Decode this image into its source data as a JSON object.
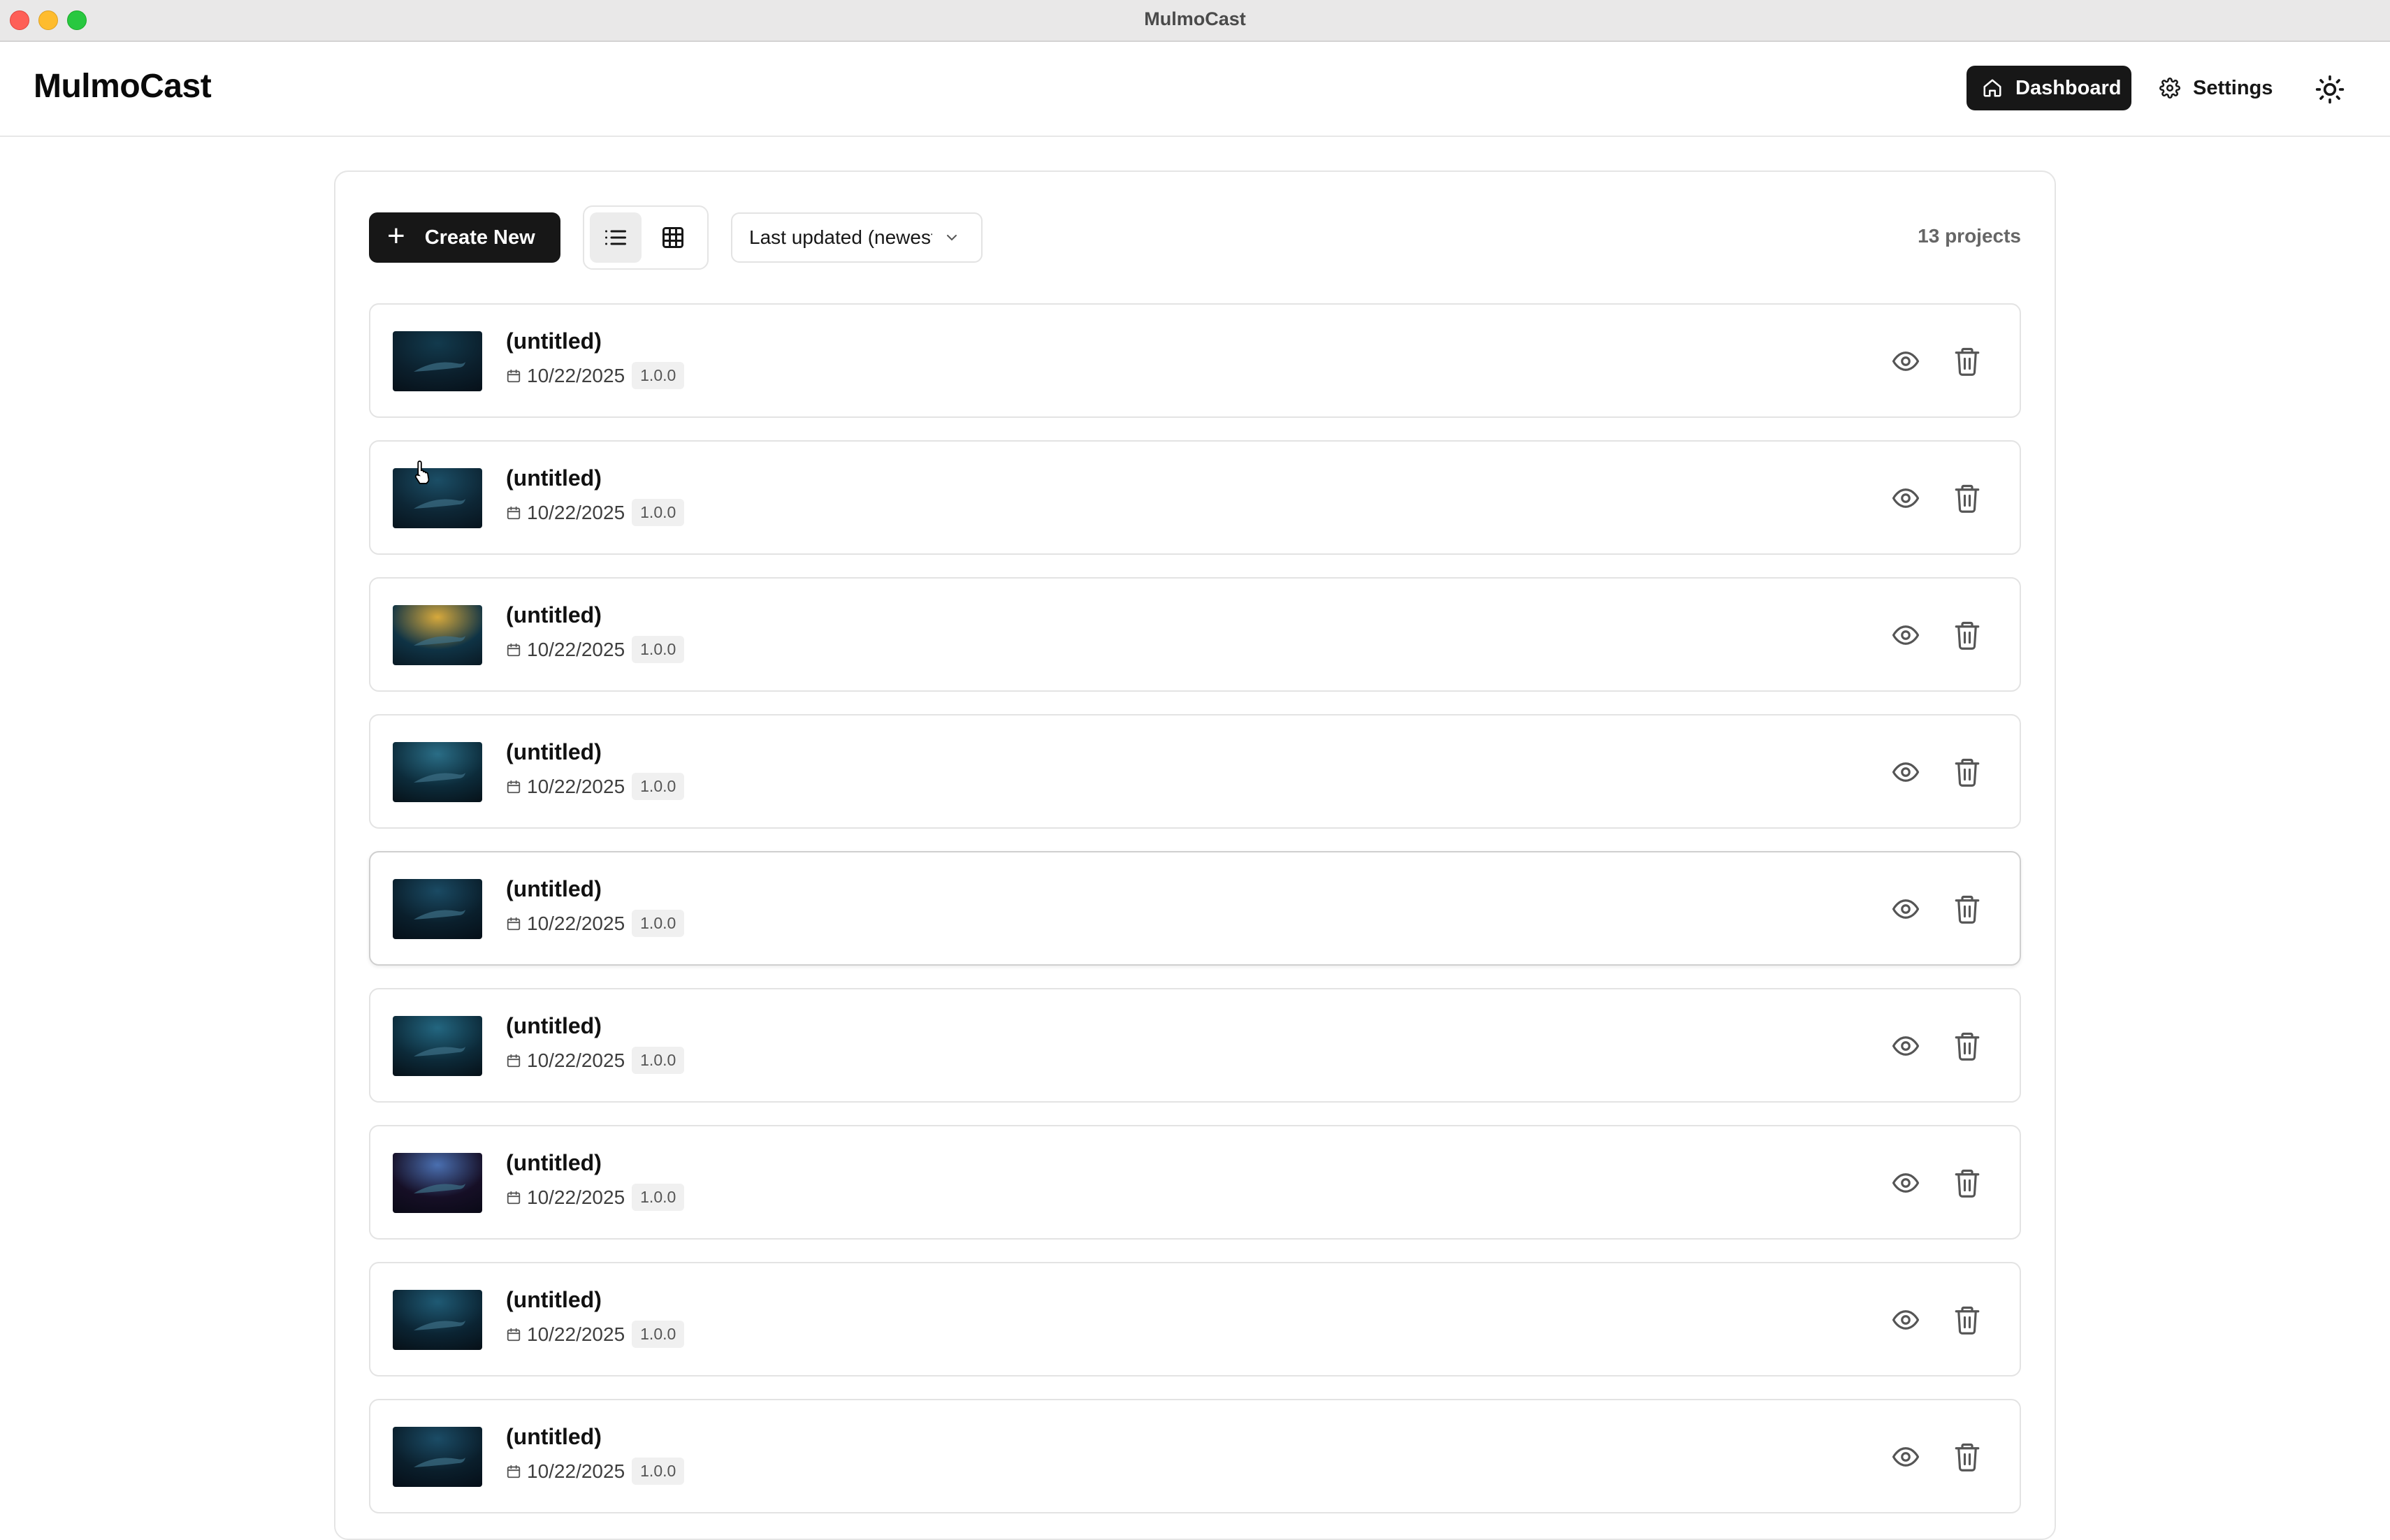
{
  "window": {
    "title": "MulmoCast"
  },
  "header": {
    "brand": "MulmoCast",
    "nav": {
      "dashboard_label": "Dashboard",
      "settings_label": "Settings"
    },
    "theme_icon": "sun-icon"
  },
  "toolbar": {
    "create_label": "Create New",
    "view_modes": [
      "list-view-icon",
      "grid-view-icon"
    ],
    "active_view": "list",
    "sort_label": "Last updated (newest first)",
    "project_count": "13 projects"
  },
  "projects": [
    {
      "title": "(untitled)",
      "date": "10/22/2025",
      "version": "1.0.0"
    },
    {
      "title": "(untitled)",
      "date": "10/22/2025",
      "version": "1.0.0"
    },
    {
      "title": "(untitled)",
      "date": "10/22/2025",
      "version": "1.0.0"
    },
    {
      "title": "(untitled)",
      "date": "10/22/2025",
      "version": "1.0.0"
    },
    {
      "title": "(untitled)",
      "date": "10/22/2025",
      "version": "1.0.0"
    },
    {
      "title": "(untitled)",
      "date": "10/22/2025",
      "version": "1.0.0"
    },
    {
      "title": "(untitled)",
      "date": "10/22/2025",
      "version": "1.0.0"
    },
    {
      "title": "(untitled)",
      "date": "10/22/2025",
      "version": "1.0.0"
    },
    {
      "title": "(untitled)",
      "date": "10/22/2025",
      "version": "1.0.0"
    }
  ],
  "colors": {
    "primary": "#171717",
    "border": "#e5e5e5",
    "muted_text": "#666666"
  }
}
